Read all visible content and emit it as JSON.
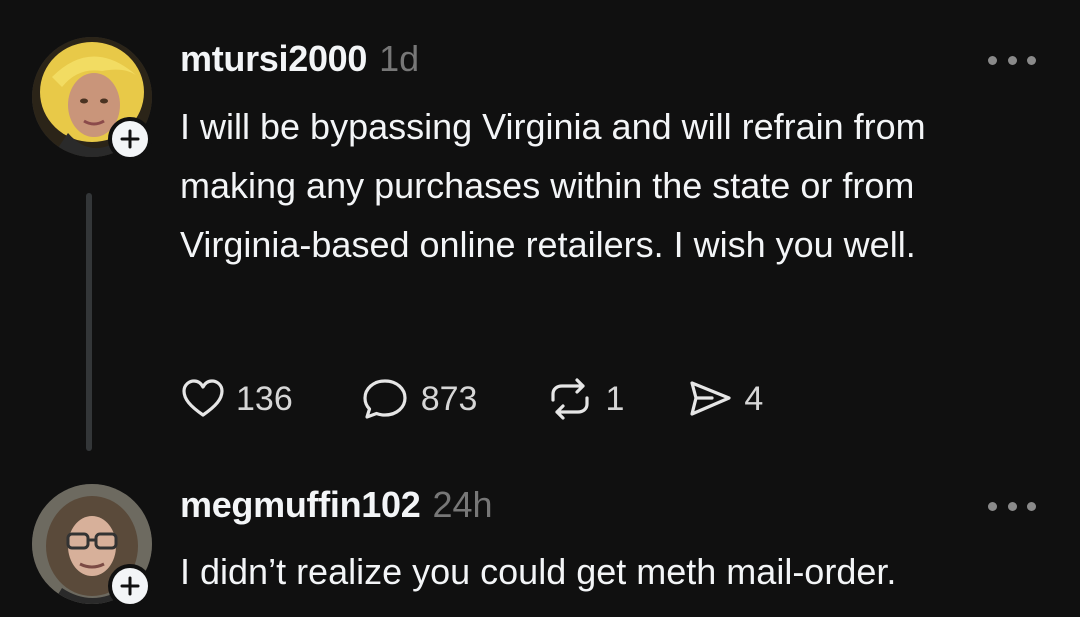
{
  "posts": [
    {
      "username": "mtursi2000",
      "timestamp": "1d",
      "text": "I will be bypassing Virginia and will refrain from making any purchases within the state or from Virginia-based online retailers. I wish you well.",
      "actions": {
        "likes": "136",
        "replies": "873",
        "reposts": "1",
        "shares": "4"
      }
    },
    {
      "username": "megmuffin102",
      "timestamp": "24h",
      "text": "I didn’t realize you could get meth mail-order."
    }
  ],
  "icons": {
    "like": "heart-icon",
    "reply": "comment-bubble-icon",
    "repost": "repost-icon",
    "share": "send-icon",
    "more": "more-options-icon",
    "follow": "plus-icon"
  },
  "colors": {
    "background": "#101010",
    "text": "#f3f5f7",
    "muted": "#777777",
    "thread_line": "#333638"
  }
}
